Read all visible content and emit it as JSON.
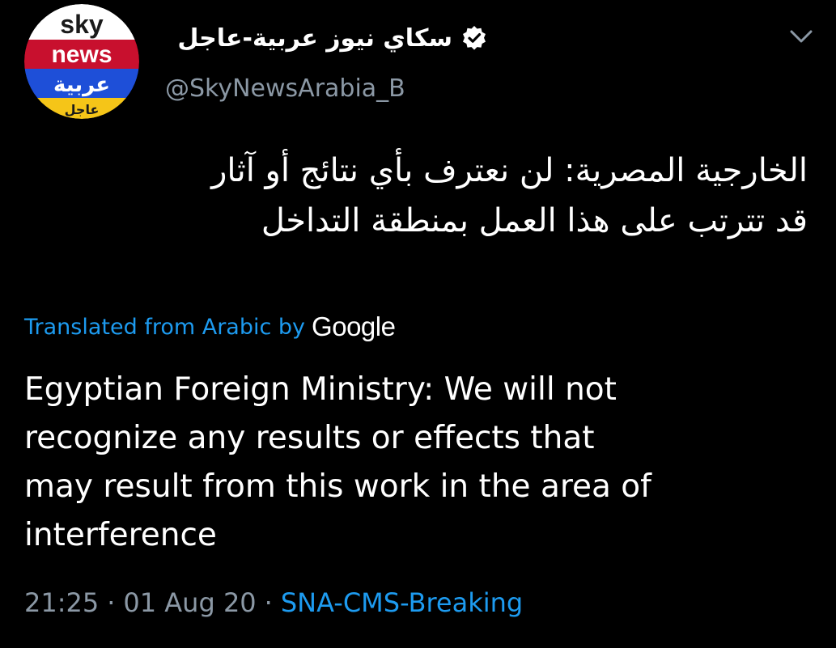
{
  "tweet": {
    "avatar": {
      "logo_line1": "sky",
      "logo_line2": "news",
      "logo_line3": "عربية",
      "logo_line4": "عاجل",
      "colors": {
        "top": "#ffffff",
        "middle": "#c8102e",
        "bottom": "#1e4fd8",
        "strip": "#f5c518"
      }
    },
    "display_name": "سكاي نيوز عربية-عاجل",
    "verified_icon": "verified-badge-icon",
    "handle": "@SkyNewsArabia_B",
    "caret_icon": "chevron-down-icon",
    "original_text_lines": [
      "الخارجية المصرية: لن نعترف بأي نتائج أو آثار",
      "قد تترتب على هذا العمل بمنطقة التداخل"
    ],
    "translation": {
      "label": "Translated from Arabic by",
      "provider": "Google",
      "text_lines": [
        "Egyptian Foreign Ministry: We will not",
        "recognize any results or effects that",
        "may result from this work in the area of",
        "interference"
      ]
    },
    "meta": {
      "time": "21:25",
      "separator": "·",
      "date": "01 Aug 20",
      "source": "SNA-CMS-Breaking"
    }
  },
  "colors": {
    "background": "#000000",
    "text_primary": "#ffffff",
    "text_secondary": "#8b98a5",
    "link": "#1d9bf0"
  }
}
